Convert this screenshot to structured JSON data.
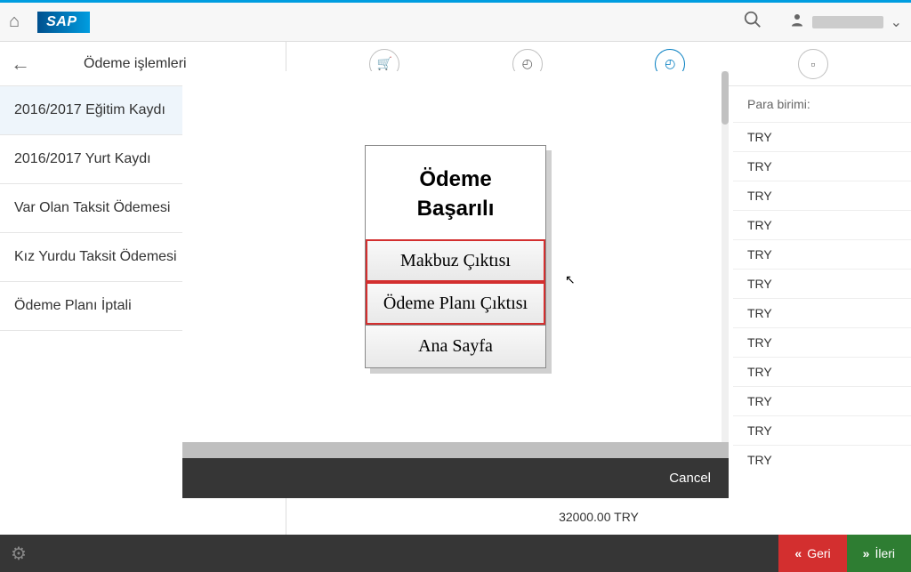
{
  "header": {
    "sap_label": "SAP"
  },
  "sidebar": {
    "title": "Ödeme işlemleri",
    "items": [
      {
        "label": "2016/2017 Eğitim Kaydı",
        "selected": true
      },
      {
        "label": "2016/2017 Yurt Kaydı",
        "selected": false
      },
      {
        "label": "Var Olan Taksit Ödemesi",
        "selected": false
      },
      {
        "label": "Kız Yurdu Taksit Ödemesi",
        "selected": false
      },
      {
        "label": "Ödeme Planı İptali",
        "selected": false
      }
    ]
  },
  "right": {
    "header": "Para birimi:",
    "rows": [
      "TRY",
      "TRY",
      "TRY",
      "TRY",
      "TRY",
      "TRY",
      "TRY",
      "TRY",
      "TRY",
      "TRY",
      "TRY",
      "TRY"
    ]
  },
  "total": "32000.00 TRY",
  "footer": {
    "back": "Geri",
    "next": "İleri"
  },
  "modal": {
    "title_line1": "Ödeme",
    "title_line2": "Başarılı",
    "btn1": "Makbuz Çıktısı",
    "btn2": "Ödeme Planı Çıktısı",
    "btn3": "Ana Sayfa",
    "cancel": "Cancel"
  }
}
